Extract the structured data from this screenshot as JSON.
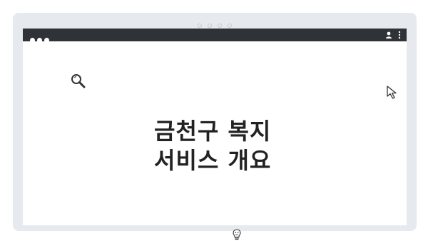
{
  "window": {
    "title_line_1": "금천구 복지",
    "title_line_2": "서비스 개요"
  },
  "icons": {
    "search": "search-icon",
    "cursor": "cursor-arrow-icon",
    "bulb": "lightbulb-icon",
    "user": "user-icon",
    "menu": "kebab-menu-icon"
  },
  "colors": {
    "frame": "#e6eaef",
    "titlebar": "#2f3338",
    "text": "#222222"
  }
}
